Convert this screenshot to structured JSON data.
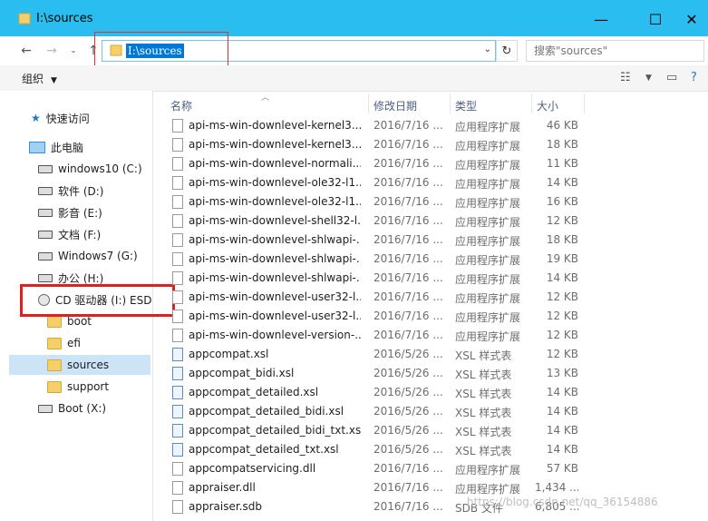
{
  "window": {
    "title": "I:\\sources",
    "minimize": "—",
    "maximize": "☐",
    "close": "✕"
  },
  "address": {
    "path": "I:\\sources",
    "search_placeholder": "搜索\"sources\""
  },
  "toolbar": {
    "organize": "组织"
  },
  "nav": {
    "quick_access": "快速访问",
    "this_pc": "此电脑",
    "drives": [
      {
        "label": "windows10 (C:)"
      },
      {
        "label": "软件 (D:)"
      },
      {
        "label": "影音 (E:)"
      },
      {
        "label": "文档 (F:)"
      },
      {
        "label": "Windows7 (G:)"
      },
      {
        "label": "办公 (H:)"
      },
      {
        "label": "CD 驱动器 (I:) ESD"
      }
    ],
    "folders": [
      {
        "label": "boot"
      },
      {
        "label": "efi"
      },
      {
        "label": "sources"
      },
      {
        "label": "support"
      }
    ],
    "boot_drive": "Boot (X:)"
  },
  "columns": {
    "name": "名称",
    "date": "修改日期",
    "type": "类型",
    "size": "大小"
  },
  "files": [
    {
      "name": "api-ms-win-downlevel-kernel3...",
      "date": "2016/7/16 ...",
      "type": "应用程序扩展",
      "size": "46 KB",
      "icon": "dll-icon"
    },
    {
      "name": "api-ms-win-downlevel-kernel3...",
      "date": "2016/7/16 ...",
      "type": "应用程序扩展",
      "size": "18 KB",
      "icon": "dll-icon"
    },
    {
      "name": "api-ms-win-downlevel-normali...",
      "date": "2016/7/16 ...",
      "type": "应用程序扩展",
      "size": "11 KB",
      "icon": "dll-icon"
    },
    {
      "name": "api-ms-win-downlevel-ole32-l1...",
      "date": "2016/7/16 ...",
      "type": "应用程序扩展",
      "size": "14 KB",
      "icon": "dll-icon"
    },
    {
      "name": "api-ms-win-downlevel-ole32-l1...",
      "date": "2016/7/16 ...",
      "type": "应用程序扩展",
      "size": "16 KB",
      "icon": "dll-icon"
    },
    {
      "name": "api-ms-win-downlevel-shell32-l...",
      "date": "2016/7/16 ...",
      "type": "应用程序扩展",
      "size": "12 KB",
      "icon": "dll-icon"
    },
    {
      "name": "api-ms-win-downlevel-shlwapi-...",
      "date": "2016/7/16 ...",
      "type": "应用程序扩展",
      "size": "18 KB",
      "icon": "dll-icon"
    },
    {
      "name": "api-ms-win-downlevel-shlwapi-...",
      "date": "2016/7/16 ...",
      "type": "应用程序扩展",
      "size": "19 KB",
      "icon": "dll-icon"
    },
    {
      "name": "api-ms-win-downlevel-shlwapi-...",
      "date": "2016/7/16 ...",
      "type": "应用程序扩展",
      "size": "14 KB",
      "icon": "dll-icon"
    },
    {
      "name": "api-ms-win-downlevel-user32-l...",
      "date": "2016/7/16 ...",
      "type": "应用程序扩展",
      "size": "12 KB",
      "icon": "dll-icon"
    },
    {
      "name": "api-ms-win-downlevel-user32-l...",
      "date": "2016/7/16 ...",
      "type": "应用程序扩展",
      "size": "12 KB",
      "icon": "dll-icon"
    },
    {
      "name": "api-ms-win-downlevel-version-...",
      "date": "2016/7/16 ...",
      "type": "应用程序扩展",
      "size": "12 KB",
      "icon": "dll-icon"
    },
    {
      "name": "appcompat.xsl",
      "date": "2016/5/26 ...",
      "type": "XSL 样式表",
      "size": "12 KB",
      "icon": "xsl-icon"
    },
    {
      "name": "appcompat_bidi.xsl",
      "date": "2016/5/26 ...",
      "type": "XSL 样式表",
      "size": "13 KB",
      "icon": "xsl-icon"
    },
    {
      "name": "appcompat_detailed.xsl",
      "date": "2016/5/26 ...",
      "type": "XSL 样式表",
      "size": "14 KB",
      "icon": "xsl-icon"
    },
    {
      "name": "appcompat_detailed_bidi.xsl",
      "date": "2016/5/26 ...",
      "type": "XSL 样式表",
      "size": "14 KB",
      "icon": "xsl-icon"
    },
    {
      "name": "appcompat_detailed_bidi_txt.xsl",
      "date": "2016/5/26 ...",
      "type": "XSL 样式表",
      "size": "14 KB",
      "icon": "xsl-icon"
    },
    {
      "name": "appcompat_detailed_txt.xsl",
      "date": "2016/5/26 ...",
      "type": "XSL 样式表",
      "size": "14 KB",
      "icon": "xsl-icon"
    },
    {
      "name": "appcompatservicing.dll",
      "date": "2016/7/16 ...",
      "type": "应用程序扩展",
      "size": "57 KB",
      "icon": "dll-icon"
    },
    {
      "name": "appraiser.dll",
      "date": "2016/7/16 ...",
      "type": "应用程序扩展",
      "size": "1,434 ...",
      "icon": "dll-icon"
    },
    {
      "name": "appraiser.sdb",
      "date": "2016/7/16 ...",
      "type": "SDB 文件",
      "size": "6,805 ...",
      "icon": "file-icon"
    }
  ],
  "watermark": "https://blog.csdn.net/qq_36154886",
  "colors": {
    "titlebar": "#29bdf0",
    "selection": "#0078d7",
    "highlight_box": "#e02020"
  }
}
